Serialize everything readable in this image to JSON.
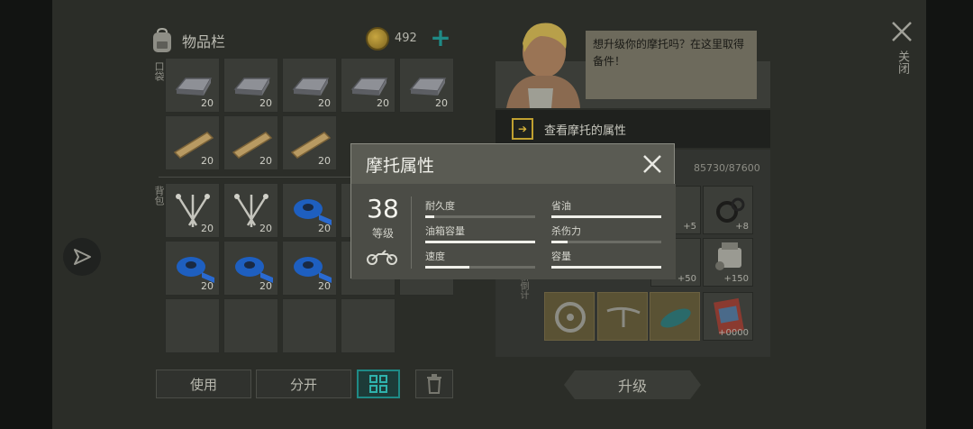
{
  "inventory": {
    "title": "物品栏",
    "coins": "492",
    "pocket_label": "口袋",
    "backpack_label": "背包",
    "slots": [
      {
        "item": "iron-ingot",
        "qty": "20"
      },
      {
        "item": "iron-ingot",
        "qty": "20"
      },
      {
        "item": "iron-ingot",
        "qty": "20"
      },
      {
        "item": "iron-ingot",
        "qty": "20"
      },
      {
        "item": "iron-ingot",
        "qty": "20"
      },
      {
        "item": "wood-plank",
        "qty": "20"
      },
      {
        "item": "wood-plank",
        "qty": "20"
      },
      {
        "item": "wood-plank",
        "qty": "20"
      },
      {
        "item": "nails",
        "qty": "20"
      },
      {
        "item": "nails",
        "qty": "20"
      },
      {
        "item": "blue-tape",
        "qty": "20"
      },
      {
        "item": "blue-tape",
        "qty": "20"
      },
      {
        "item": "blue-tape",
        "qty": "20"
      },
      {
        "item": "blue-tape",
        "qty": "20"
      }
    ]
  },
  "buttons": {
    "use": "使用",
    "split": "分开",
    "upgrade": "升级"
  },
  "npc": {
    "speech": "想升级你的摩托吗？在这里取得备件！"
  },
  "motorcycle": {
    "view_label": "查看摩托的属性",
    "progress": "85730/87600",
    "parts_side": "刷新倒计",
    "part_bonuses": [
      "+5",
      "+8",
      "+50",
      "+150",
      "+0000"
    ]
  },
  "close": {
    "label": "关闭"
  },
  "modal": {
    "title": "摩托属性",
    "level": "38",
    "level_label": "等级",
    "stats": [
      {
        "label": "耐久度",
        "fill": 0.08
      },
      {
        "label": "省油",
        "fill": 1.0
      },
      {
        "label": "油箱容量",
        "fill": 1.0
      },
      {
        "label": "杀伤力",
        "fill": 0.15
      },
      {
        "label": "速度",
        "fill": 0.4
      },
      {
        "label": "容量",
        "fill": 1.0
      }
    ]
  },
  "colors": {
    "accent_teal": "#1f8a86",
    "coin_gold": "#c8a640",
    "arrow_gold": "#d8b43a"
  }
}
